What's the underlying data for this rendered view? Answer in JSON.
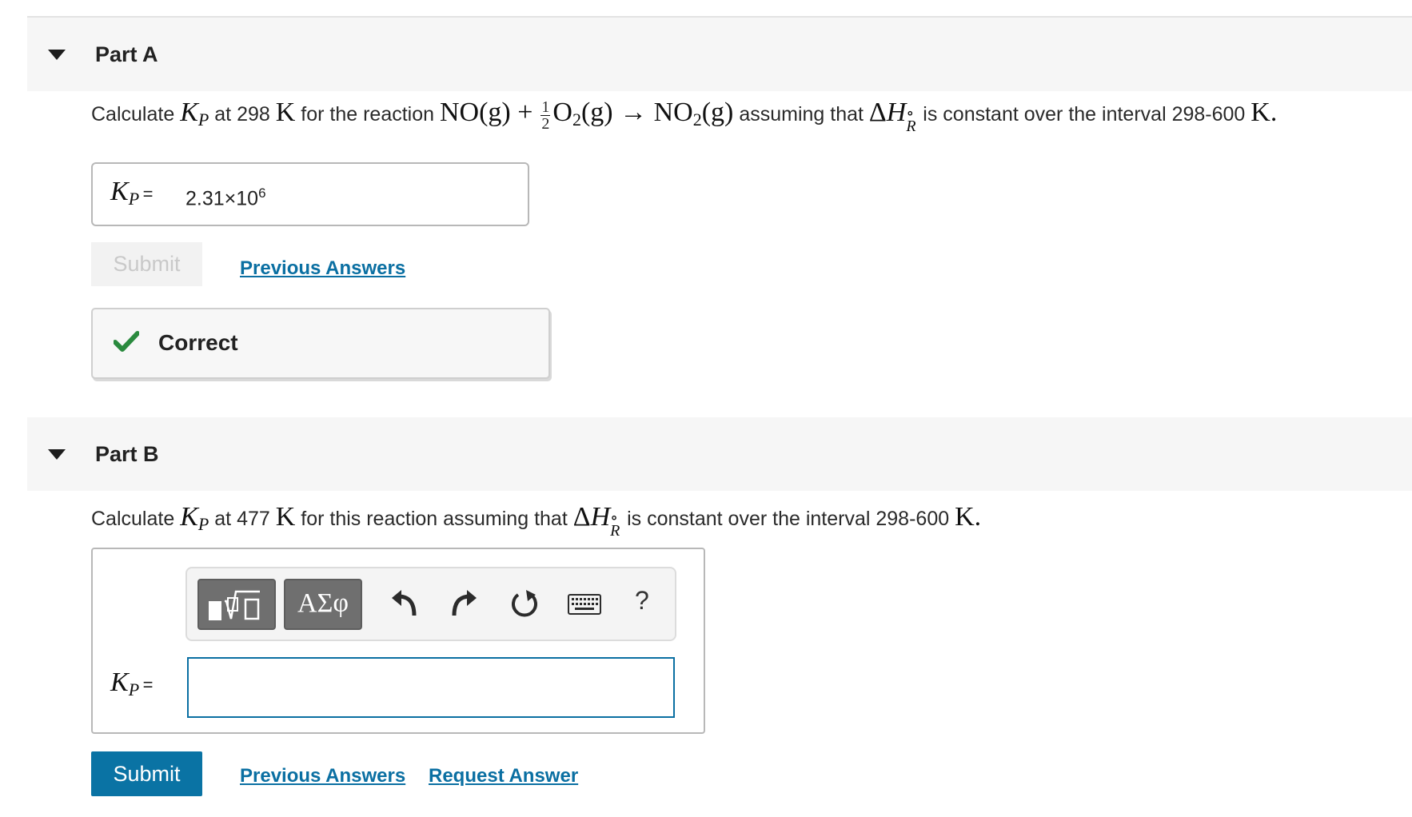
{
  "part_a": {
    "title": "Part A",
    "question": {
      "calculate": "Calculate",
      "at": "at 298",
      "for_the_reaction": "for the reaction",
      "assuming": "assuming that",
      "constant": "is constant over the interval 298-600"
    },
    "answer_value": "2.31×10",
    "answer_exponent": "6",
    "submit_label": "Submit",
    "previous_answers_label": "Previous Answers",
    "feedback": "Correct"
  },
  "part_b": {
    "title": "Part B",
    "question": {
      "calculate": "Calculate",
      "at": "at 477",
      "for_this_reaction": "for this reaction assuming that",
      "constant": "is constant over the interval 298-600"
    },
    "toolbar": {
      "greek_label": "ΑΣφ",
      "help_label": "?"
    },
    "input_value": "",
    "submit_label": "Submit",
    "previous_answers_label": "Previous Answers",
    "request_answer_label": "Request Answer"
  },
  "math": {
    "K": "K",
    "P": "P",
    "equals": "=",
    "kelvin": "K",
    "period": ".",
    "reaction": {
      "no": "NO(g) +",
      "half_num": "1",
      "half_den": "2",
      "o": "O",
      "o_sub": "2",
      "o_after": "(g) → NO",
      "no2_sub": "2",
      "no2_after": "(g)"
    },
    "delta_h": "ΔH",
    "delta_h_sup": "∘",
    "delta_h_sub": "R"
  },
  "colors": {
    "accent": "#0a73a4",
    "link": "#0a6fa2",
    "correct": "#2a8a3e"
  }
}
